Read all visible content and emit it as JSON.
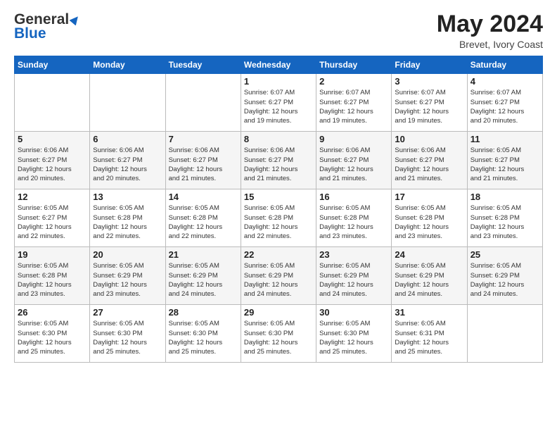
{
  "header": {
    "logo_general": "General",
    "logo_blue": "Blue",
    "month_title": "May 2024",
    "location": "Brevet, Ivory Coast"
  },
  "days_of_week": [
    "Sunday",
    "Monday",
    "Tuesday",
    "Wednesday",
    "Thursday",
    "Friday",
    "Saturday"
  ],
  "weeks": [
    [
      {
        "day": "",
        "info": ""
      },
      {
        "day": "",
        "info": ""
      },
      {
        "day": "",
        "info": ""
      },
      {
        "day": "1",
        "info": "Sunrise: 6:07 AM\nSunset: 6:27 PM\nDaylight: 12 hours\nand 19 minutes."
      },
      {
        "day": "2",
        "info": "Sunrise: 6:07 AM\nSunset: 6:27 PM\nDaylight: 12 hours\nand 19 minutes."
      },
      {
        "day": "3",
        "info": "Sunrise: 6:07 AM\nSunset: 6:27 PM\nDaylight: 12 hours\nand 19 minutes."
      },
      {
        "day": "4",
        "info": "Sunrise: 6:07 AM\nSunset: 6:27 PM\nDaylight: 12 hours\nand 20 minutes."
      }
    ],
    [
      {
        "day": "5",
        "info": "Sunrise: 6:06 AM\nSunset: 6:27 PM\nDaylight: 12 hours\nand 20 minutes."
      },
      {
        "day": "6",
        "info": "Sunrise: 6:06 AM\nSunset: 6:27 PM\nDaylight: 12 hours\nand 20 minutes."
      },
      {
        "day": "7",
        "info": "Sunrise: 6:06 AM\nSunset: 6:27 PM\nDaylight: 12 hours\nand 21 minutes."
      },
      {
        "day": "8",
        "info": "Sunrise: 6:06 AM\nSunset: 6:27 PM\nDaylight: 12 hours\nand 21 minutes."
      },
      {
        "day": "9",
        "info": "Sunrise: 6:06 AM\nSunset: 6:27 PM\nDaylight: 12 hours\nand 21 minutes."
      },
      {
        "day": "10",
        "info": "Sunrise: 6:06 AM\nSunset: 6:27 PM\nDaylight: 12 hours\nand 21 minutes."
      },
      {
        "day": "11",
        "info": "Sunrise: 6:05 AM\nSunset: 6:27 PM\nDaylight: 12 hours\nand 21 minutes."
      }
    ],
    [
      {
        "day": "12",
        "info": "Sunrise: 6:05 AM\nSunset: 6:27 PM\nDaylight: 12 hours\nand 22 minutes."
      },
      {
        "day": "13",
        "info": "Sunrise: 6:05 AM\nSunset: 6:28 PM\nDaylight: 12 hours\nand 22 minutes."
      },
      {
        "day": "14",
        "info": "Sunrise: 6:05 AM\nSunset: 6:28 PM\nDaylight: 12 hours\nand 22 minutes."
      },
      {
        "day": "15",
        "info": "Sunrise: 6:05 AM\nSunset: 6:28 PM\nDaylight: 12 hours\nand 22 minutes."
      },
      {
        "day": "16",
        "info": "Sunrise: 6:05 AM\nSunset: 6:28 PM\nDaylight: 12 hours\nand 23 minutes."
      },
      {
        "day": "17",
        "info": "Sunrise: 6:05 AM\nSunset: 6:28 PM\nDaylight: 12 hours\nand 23 minutes."
      },
      {
        "day": "18",
        "info": "Sunrise: 6:05 AM\nSunset: 6:28 PM\nDaylight: 12 hours\nand 23 minutes."
      }
    ],
    [
      {
        "day": "19",
        "info": "Sunrise: 6:05 AM\nSunset: 6:28 PM\nDaylight: 12 hours\nand 23 minutes."
      },
      {
        "day": "20",
        "info": "Sunrise: 6:05 AM\nSunset: 6:29 PM\nDaylight: 12 hours\nand 23 minutes."
      },
      {
        "day": "21",
        "info": "Sunrise: 6:05 AM\nSunset: 6:29 PM\nDaylight: 12 hours\nand 24 minutes."
      },
      {
        "day": "22",
        "info": "Sunrise: 6:05 AM\nSunset: 6:29 PM\nDaylight: 12 hours\nand 24 minutes."
      },
      {
        "day": "23",
        "info": "Sunrise: 6:05 AM\nSunset: 6:29 PM\nDaylight: 12 hours\nand 24 minutes."
      },
      {
        "day": "24",
        "info": "Sunrise: 6:05 AM\nSunset: 6:29 PM\nDaylight: 12 hours\nand 24 minutes."
      },
      {
        "day": "25",
        "info": "Sunrise: 6:05 AM\nSunset: 6:29 PM\nDaylight: 12 hours\nand 24 minutes."
      }
    ],
    [
      {
        "day": "26",
        "info": "Sunrise: 6:05 AM\nSunset: 6:30 PM\nDaylight: 12 hours\nand 25 minutes."
      },
      {
        "day": "27",
        "info": "Sunrise: 6:05 AM\nSunset: 6:30 PM\nDaylight: 12 hours\nand 25 minutes."
      },
      {
        "day": "28",
        "info": "Sunrise: 6:05 AM\nSunset: 6:30 PM\nDaylight: 12 hours\nand 25 minutes."
      },
      {
        "day": "29",
        "info": "Sunrise: 6:05 AM\nSunset: 6:30 PM\nDaylight: 12 hours\nand 25 minutes."
      },
      {
        "day": "30",
        "info": "Sunrise: 6:05 AM\nSunset: 6:30 PM\nDaylight: 12 hours\nand 25 minutes."
      },
      {
        "day": "31",
        "info": "Sunrise: 6:05 AM\nSunset: 6:31 PM\nDaylight: 12 hours\nand 25 minutes."
      },
      {
        "day": "",
        "info": ""
      }
    ]
  ]
}
